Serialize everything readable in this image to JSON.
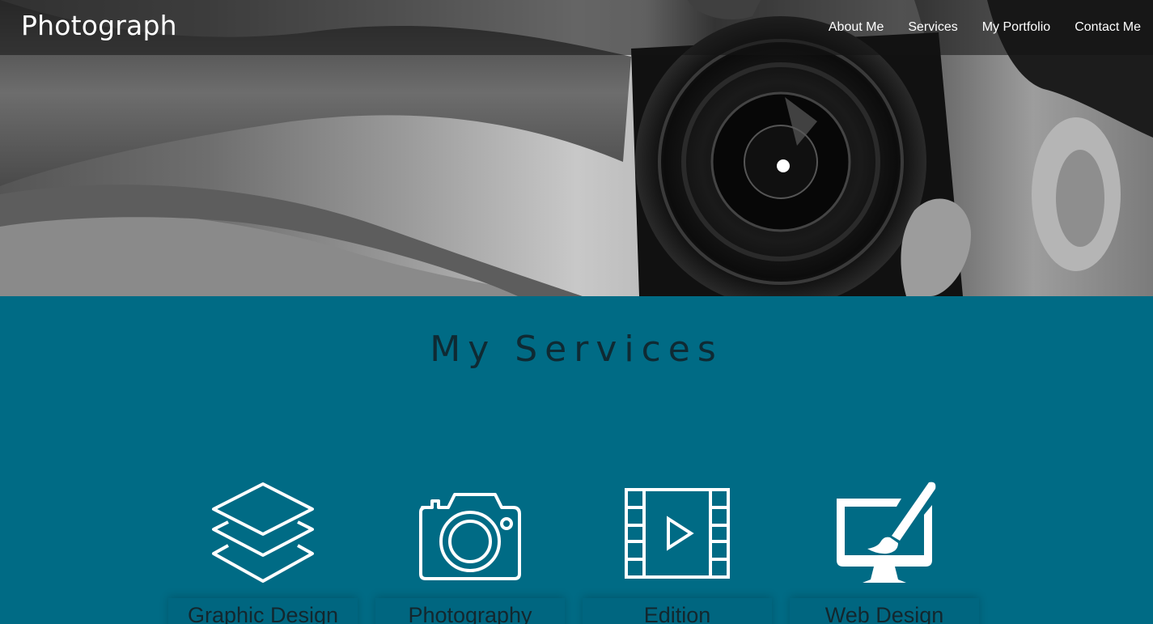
{
  "navbar": {
    "brand": "Photograph",
    "links": [
      {
        "label": "About Me"
      },
      {
        "label": "Services"
      },
      {
        "label": "My Portfolio"
      },
      {
        "label": "Contact Me"
      }
    ]
  },
  "hero": {
    "image_alt": "Photographer holding a camera lens to face",
    "style": "black-and-white photo"
  },
  "services": {
    "title": "My Services",
    "items": [
      {
        "label": "Graphic Design",
        "icon": "layers-icon"
      },
      {
        "label": "Photography",
        "icon": "camera-icon"
      },
      {
        "label": "Edition",
        "icon": "film-play-icon"
      },
      {
        "label": "Web Design",
        "icon": "monitor-brush-icon"
      }
    ]
  },
  "colors": {
    "section_background": "#006b85",
    "title_text": "#0f2a33",
    "icon_stroke": "#ffffff",
    "nav_text": "#ffffff"
  }
}
